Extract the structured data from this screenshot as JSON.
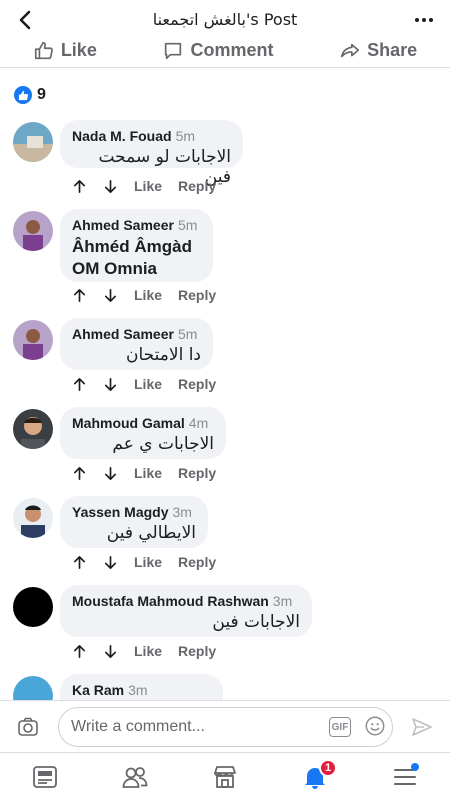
{
  "header": {
    "title": "بالغش اتجمعنا's Post"
  },
  "post_actions": {
    "like": "Like",
    "comment": "Comment",
    "share": "Share"
  },
  "reactions": {
    "count": "9"
  },
  "comment_actions": {
    "like": "Like",
    "reply": "Reply"
  },
  "comments": [
    {
      "name": "Nada M. Fouad",
      "time": "5m",
      "text": "الاجابات لو سمحت فين"
    },
    {
      "name": "Ahmed Sameer",
      "time": "5m",
      "text": "Âhméd Âmgàd OM Omnia"
    },
    {
      "name": "Ahmed Sameer",
      "time": "5m",
      "text": "دا الامتحان"
    },
    {
      "name": "Mahmoud Gamal",
      "time": "4m",
      "text": "الاجابات ي عم"
    },
    {
      "name": "Yassen Magdy",
      "time": "3m",
      "text": "الايطالي فين"
    },
    {
      "name": "Moustafa Mahmoud Rashwan",
      "time": "3m",
      "text": "الاجابات فين"
    },
    {
      "name": "Ka Ram",
      "time": "3m",
      "text": ""
    }
  ],
  "composer": {
    "placeholder": "Write a comment...",
    "gif_label": "GIF"
  },
  "tabbar": {
    "notifications_badge": "1"
  },
  "colors": {
    "accent": "#1877f2",
    "bubble": "#f0f2f5",
    "badge": "#e41e3f"
  }
}
